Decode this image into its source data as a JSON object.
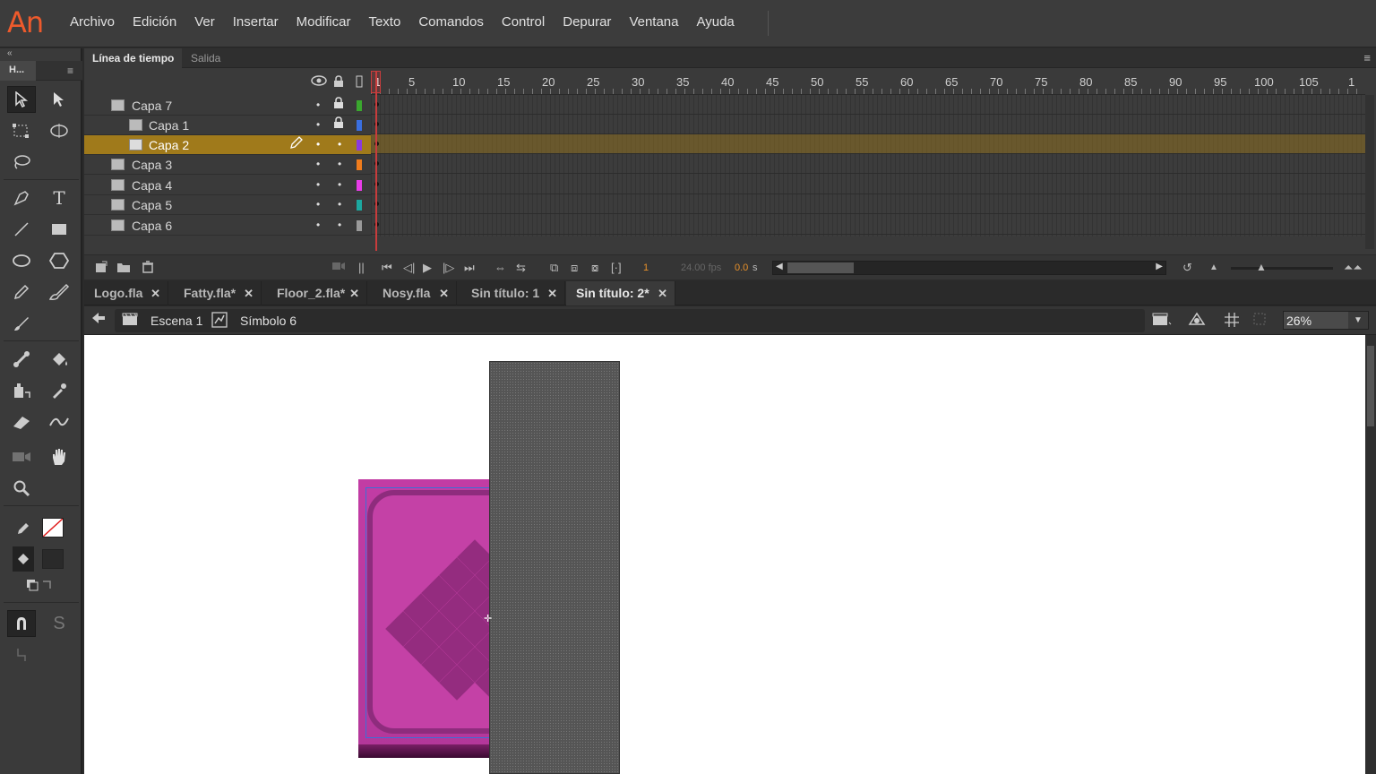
{
  "app": {
    "logo": "An"
  },
  "menu": [
    "Archivo",
    "Edición",
    "Ver",
    "Insertar",
    "Modificar",
    "Texto",
    "Comandos",
    "Control",
    "Depurar",
    "Ventana",
    "Ayuda"
  ],
  "toolbox": {
    "collapse": "«",
    "header_label": "H...",
    "menu_icon": "≡"
  },
  "timeline": {
    "tabs": [
      "Línea de tiempo",
      "Salida"
    ],
    "ruler_numbers": [
      "1",
      "5",
      "10",
      "15",
      "20",
      "25",
      "30",
      "35",
      "40",
      "45",
      "50",
      "55",
      "60",
      "65",
      "70",
      "75",
      "80",
      "85",
      "90",
      "95",
      "100",
      "105",
      "1"
    ],
    "layers": [
      {
        "name": "Capa 7",
        "color": "#3aa82e",
        "locked": true,
        "selected": false
      },
      {
        "name": "Capa 1",
        "color": "#3a6fe0",
        "locked": true,
        "selected": false
      },
      {
        "name": "Capa 2",
        "color": "#8a3ae0",
        "locked": false,
        "selected": true
      },
      {
        "name": "Capa 3",
        "color": "#f07c1c",
        "locked": false,
        "selected": false
      },
      {
        "name": "Capa 4",
        "color": "#e83ce8",
        "locked": false,
        "selected": false
      },
      {
        "name": "Capa 5",
        "color": "#1ca8a0",
        "locked": false,
        "selected": false
      },
      {
        "name": "Capa 6",
        "color": "#9a9a9a",
        "locked": false,
        "selected": false
      }
    ],
    "current_frame": "1",
    "fps": "24.00 fps",
    "time_value": "0.0",
    "time_unit": "s"
  },
  "doc_tabs": [
    {
      "label": "Logo.fla",
      "active": false
    },
    {
      "label": "Fatty.fla*",
      "active": false
    },
    {
      "label": "Floor_2.fla*",
      "active": false
    },
    {
      "label": "Nosy.fla",
      "active": false
    },
    {
      "label": "Sin título: 1",
      "active": false
    },
    {
      "label": "Sin título: 2*",
      "active": true
    }
  ],
  "breadcrumb": {
    "scene": "Escena 1",
    "symbol": "Símbolo 6"
  },
  "zoom": "26%",
  "colors": {
    "accent": "#ee5a2c",
    "selected_layer": "#a07a1b",
    "playhead": "#c83c3c",
    "stage": "#ffffff",
    "pink_symbol": "#c23ca4"
  }
}
